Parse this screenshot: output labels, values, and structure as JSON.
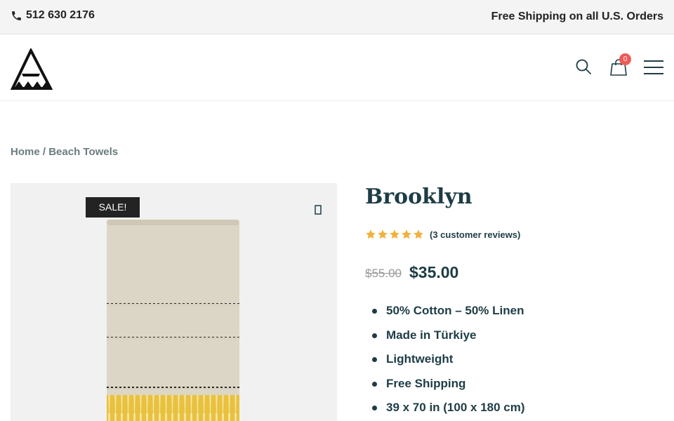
{
  "topbar": {
    "phone": "512 630 2176",
    "shipping": "Free Shipping on all U.S. Orders"
  },
  "header": {
    "cart_count": "0",
    "icons": [
      "search-icon",
      "cart-icon",
      "menu-icon"
    ]
  },
  "breadcrumb": {
    "home": "Home",
    "separator": " / ",
    "current": "Beach Towels"
  },
  "product": {
    "badge": "SALE!",
    "title": "Brooklyn",
    "rating": 5,
    "rating_max": 5,
    "reviews_label": "(3 customer reviews)",
    "price_old": "$55.00",
    "price_new": "$35.00",
    "features": [
      "50% Cotton – 50% Linen",
      "Made in Türkiye",
      "Lightweight",
      "Free Shipping",
      "39 x 70 in (100 x 180 cm)"
    ]
  },
  "colors": {
    "accent": "#1d3c45",
    "star": "#f2b13c",
    "badge_bg": "#232323",
    "cart_badge": "#f05a55",
    "towel_stripe": "#e8c13f"
  }
}
